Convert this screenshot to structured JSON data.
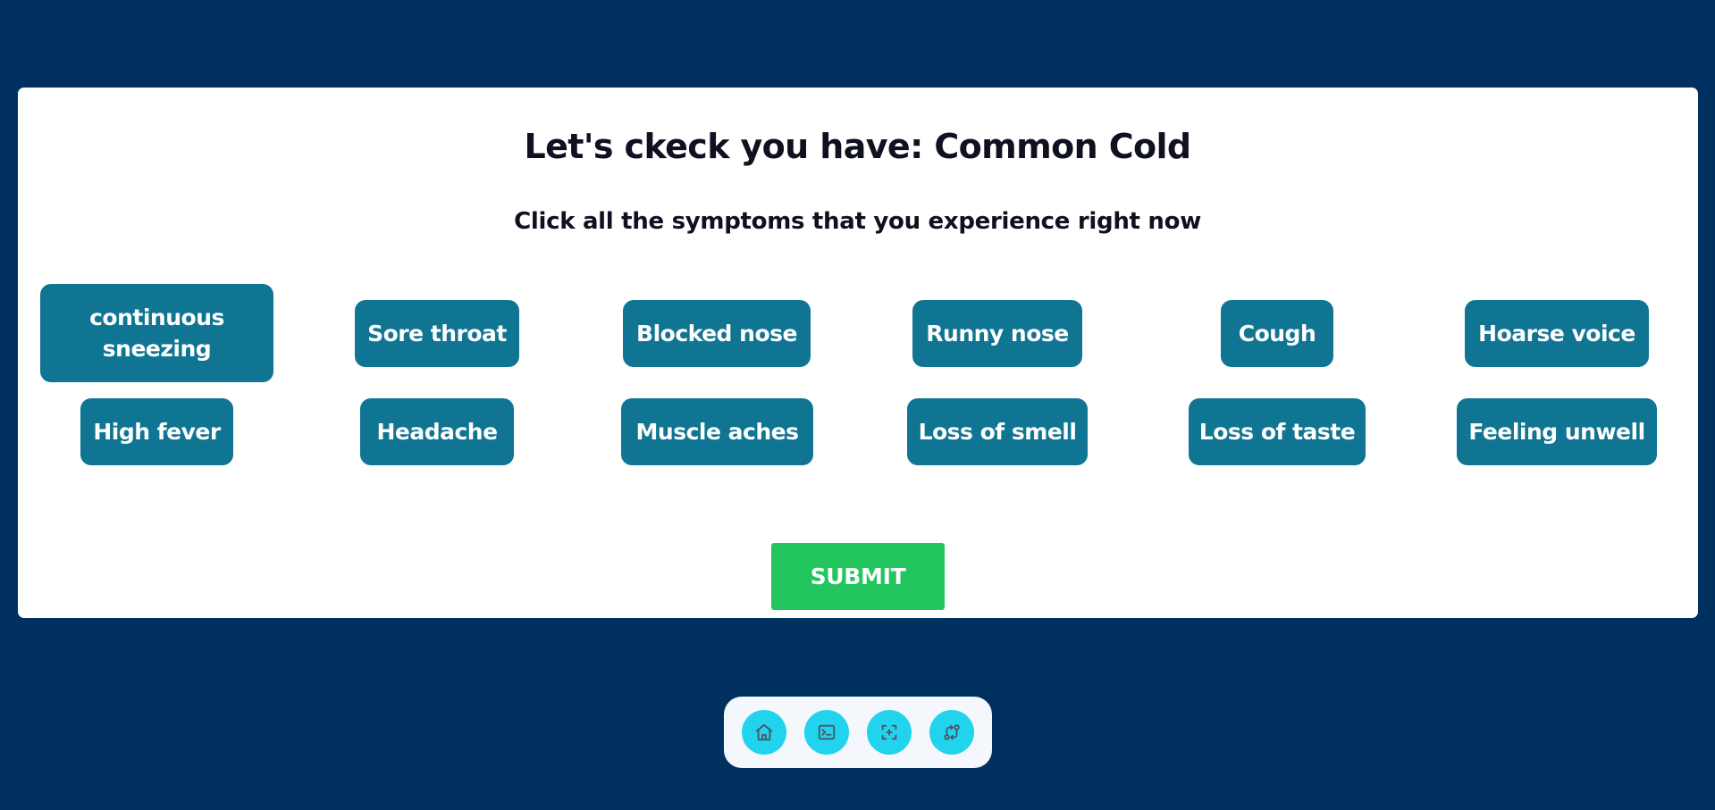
{
  "quiz": {
    "title": "Let's ckeck you have: Common Cold",
    "instruction": "Click all the symptoms that you experience right now",
    "symptoms": [
      "continuous sneezing",
      "Sore throat",
      "Blocked nose",
      "Runny nose",
      "Cough",
      "Hoarse voice",
      "High fever",
      "Headache",
      "Muscle aches",
      "Loss of smell",
      "Loss of taste",
      "Feeling unwell"
    ],
    "submit_label": "SUBMIT"
  },
  "dock": {
    "icons": [
      "home-icon",
      "terminal-icon",
      "add-screenshot-icon",
      "git-compare-icon"
    ]
  },
  "colors": {
    "background": "#003060",
    "card": "#ffffff",
    "symptom_button": "#0f7592",
    "submit_button": "#22c55e",
    "dock_button": "#22d3ee"
  }
}
